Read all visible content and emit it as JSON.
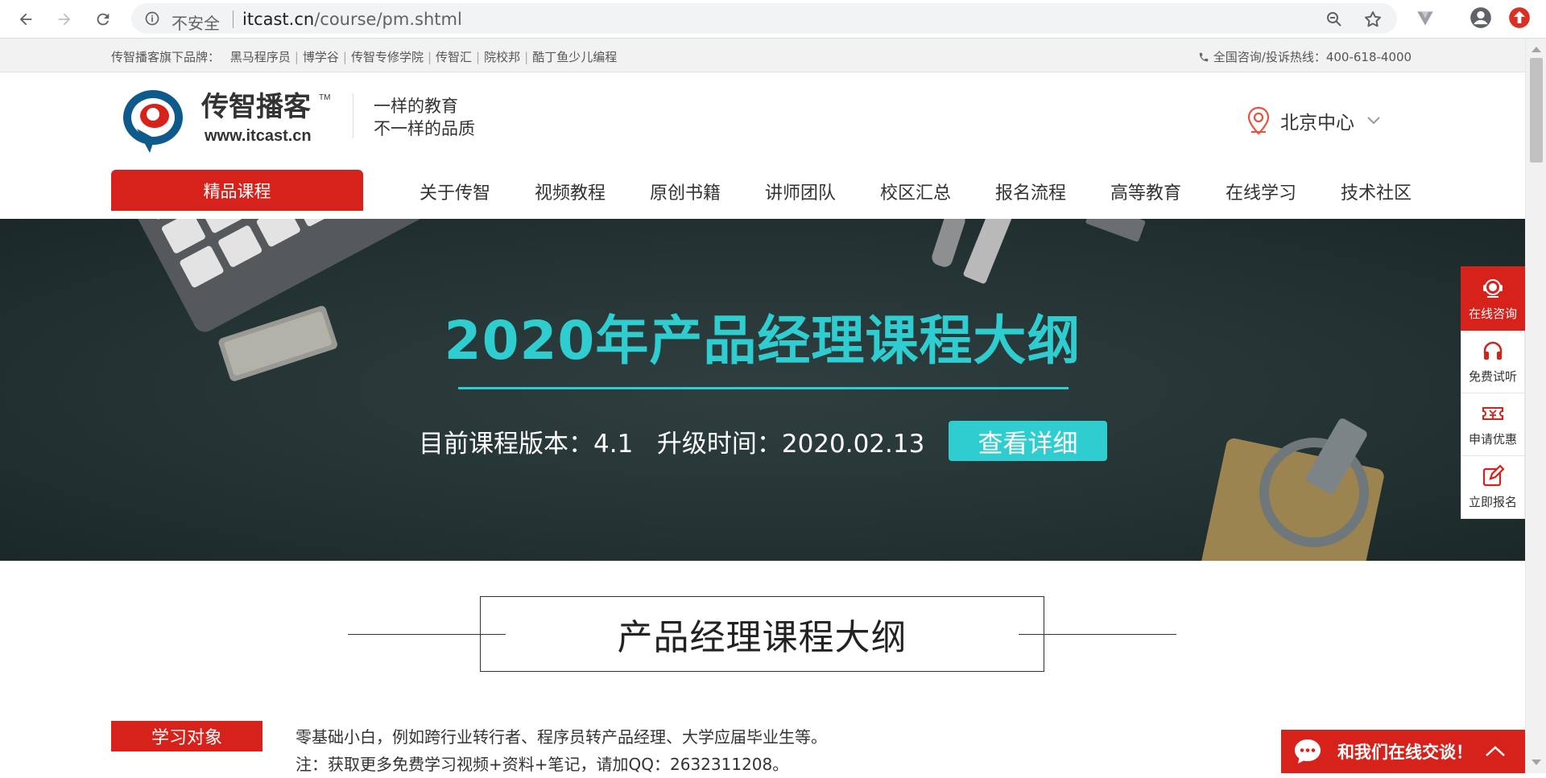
{
  "browser": {
    "security_label": "不安全",
    "url_host": "itcast.cn",
    "url_path": "/course/pm.shtml"
  },
  "topbar": {
    "brand_prefix": "传智播客旗下品牌：",
    "brands": [
      "黑马程序员",
      "博学谷",
      "传智专修学院",
      "传智汇",
      "院校邦",
      "酷丁鱼少儿编程"
    ],
    "hotline": "全国咨询/投诉热线：400-618-4000"
  },
  "header": {
    "logo_text": "传智播客",
    "logo_tm": "TM",
    "logo_url": "www.itcast.cn",
    "slogan_line1": "一样的教育",
    "slogan_line2": "不一样的品质",
    "location": "北京中心"
  },
  "nav": {
    "featured": "精品课程",
    "items": [
      "关于传智",
      "视频教程",
      "原创书籍",
      "讲师团队",
      "校区汇总",
      "报名流程",
      "高等教育",
      "在线学习",
      "技术社区"
    ]
  },
  "banner": {
    "title": "2020年产品经理课程大纲",
    "version": "目前课程版本：4.1   升级时间：2020.02.13",
    "button": "查看详细",
    "accent_color": "#2fcdd0"
  },
  "section": {
    "heading": "产品经理课程大纲",
    "target_tag": "学习对象",
    "target_line1": "零基础小白，例如跨行业转行者、程序员转产品经理、大学应届毕业生等。",
    "target_line2": "注：获取更多免费学习视频+资料+笔记，请加QQ：2632311208。"
  },
  "sidebar": {
    "items": [
      "在线咨询",
      "免费试听",
      "申请优惠",
      "立即报名"
    ]
  },
  "chat": {
    "label": "和我们在线交谈！"
  },
  "colors": {
    "brand_red": "#d7221c",
    "banner_bg": "#243333"
  }
}
